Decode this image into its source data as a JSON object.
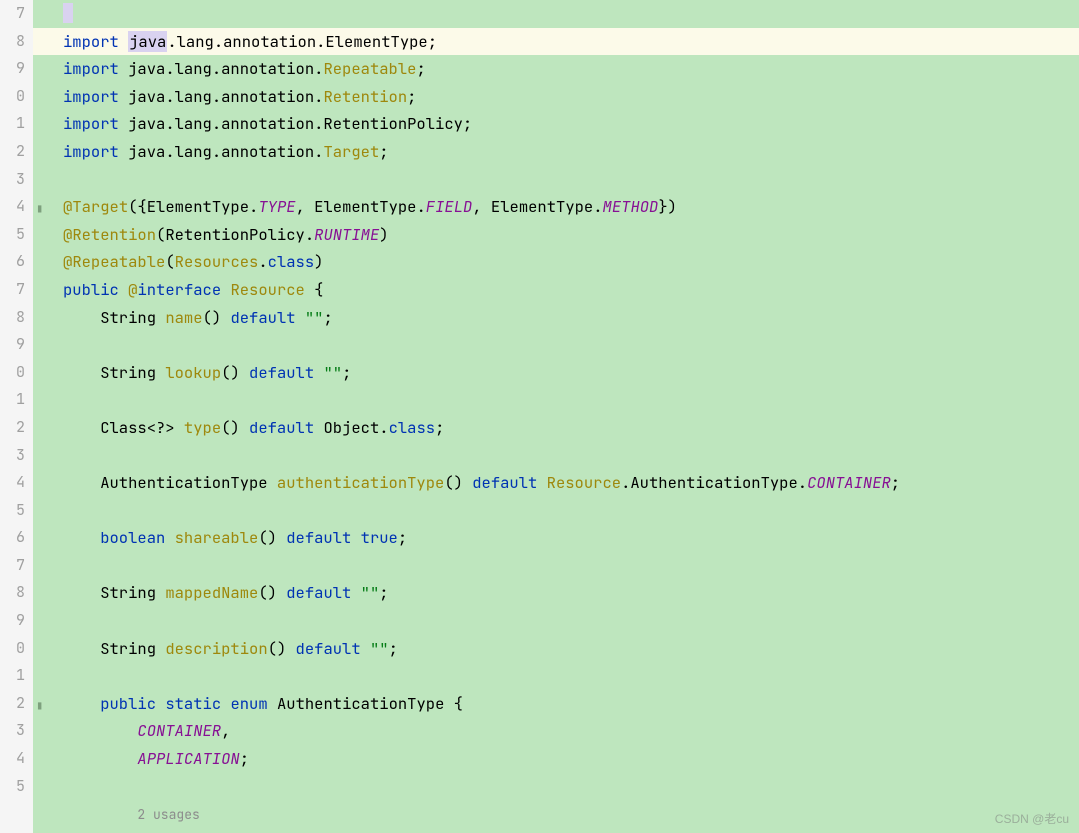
{
  "line_numbers": [
    "7",
    "8",
    "9",
    "0",
    "1",
    "2",
    "3",
    "4",
    "5",
    "6",
    "7",
    "8",
    "9",
    "0",
    "1",
    "2",
    "3",
    "4",
    "5",
    "6",
    "7",
    "8",
    "9",
    "0",
    "1",
    "2",
    "3",
    "4",
    "5"
  ],
  "code": {
    "kw_import": "import",
    "kw_public": "public",
    "kw_interface": "interface",
    "kw_default": "default",
    "kw_class": "class",
    "kw_true": "true",
    "kw_static": "static",
    "kw_enum": "enum",
    "at": "@",
    "pkg": "java",
    "pkg_rest_element": ".lang.annotation.ElementType;",
    "pkg_rest_repeatable": ".lang.annotation.",
    "pkg_rest_retention": ".lang.annotation.",
    "pkg_rest_retpolicy": ".lang.annotation.RetentionPolicy;",
    "pkg_rest_target": ".lang.annotation.",
    "ann_repeatable": "Repeatable",
    "ann_retention": "Retention",
    "ann_target": "Target",
    "cls_elementtype": "ElementType",
    "cls_retpolicy": "RetentionPolicy",
    "cls_resources": "Resources",
    "cls_resource": "Resource",
    "cls_object": "Object",
    "cls_authtype": "AuthenticationType",
    "fld_type": "TYPE",
    "fld_field": "FIELD",
    "fld_method": "METHOD",
    "fld_runtime": "RUNTIME",
    "fld_container": "CONTAINER",
    "fld_application": "APPLICATION",
    "m_name": "name",
    "m_lookup": "lookup",
    "m_type": "type",
    "m_authtype": "authenticationType",
    "m_shareable": "shareable",
    "m_mappedname": "mappedName",
    "m_description": "description",
    "t_string": "String",
    "t_class": "Class<?>",
    "t_bool": "boolean",
    "str_empty": "\"\"",
    "hint_usages": "2 usages"
  },
  "watermark": "CSDN @老cu"
}
